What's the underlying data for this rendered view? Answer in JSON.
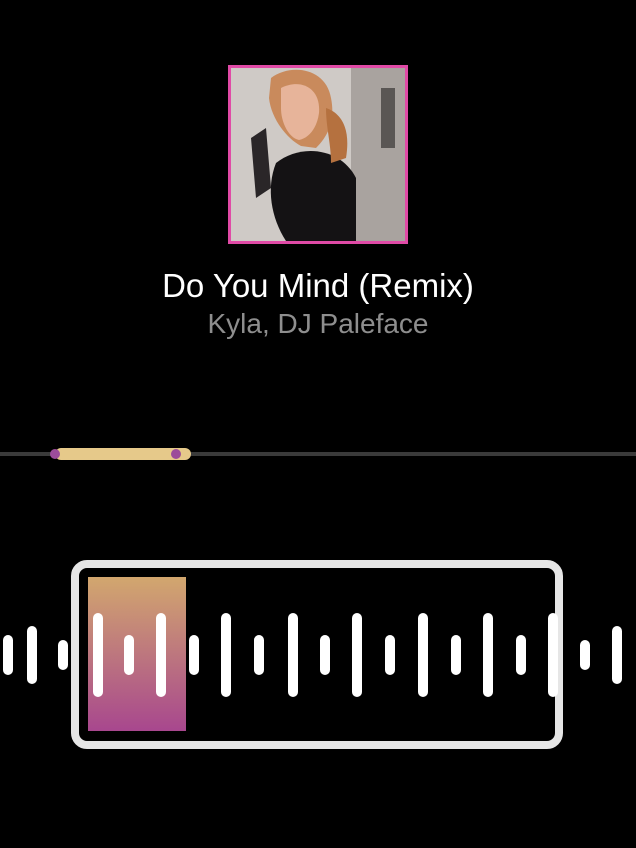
{
  "track": {
    "title": "Do You Mind (Remix)",
    "artist": "Kyla, DJ Paleface"
  },
  "clip_selector": {
    "selected_start_fraction": 0.087,
    "selected_end_fraction": 0.3,
    "playback_progress_fraction": 0.21
  },
  "colors": {
    "background": "#000000",
    "album_border": "#e04aa6",
    "timeline_selection": "#e6c98a",
    "waveform_bar": "#ffffff",
    "progress_gradient_top": "#d2a76e",
    "progress_gradient_bottom": "#a8478e"
  },
  "icons": {
    "album_art": "album-cover-image"
  }
}
